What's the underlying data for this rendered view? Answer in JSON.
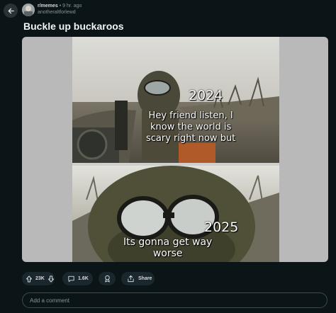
{
  "post": {
    "subreddit": "r/memes",
    "separator": "•",
    "time": "9 hr. ago",
    "user": "anotheraltforlewd",
    "title": "Buckle up buckaroos"
  },
  "meme": {
    "top_year": "2024",
    "top_text": "Hey friend listen, I\nknow the world is\nscary right now but",
    "bottom_year": "2025",
    "bottom_text": "Its gonna get way\nworse"
  },
  "actions": {
    "votes": "23K",
    "comments": "1.6K",
    "share": "Share"
  },
  "comment_box": {
    "placeholder": "Add a comment"
  },
  "colors": {
    "background": "#0b1416",
    "pill": "#1a282d",
    "muted_text": "#82959b"
  },
  "icons": [
    "back-arrow-icon",
    "upvote-icon",
    "downvote-icon",
    "comment-icon",
    "award-icon",
    "share-icon"
  ]
}
